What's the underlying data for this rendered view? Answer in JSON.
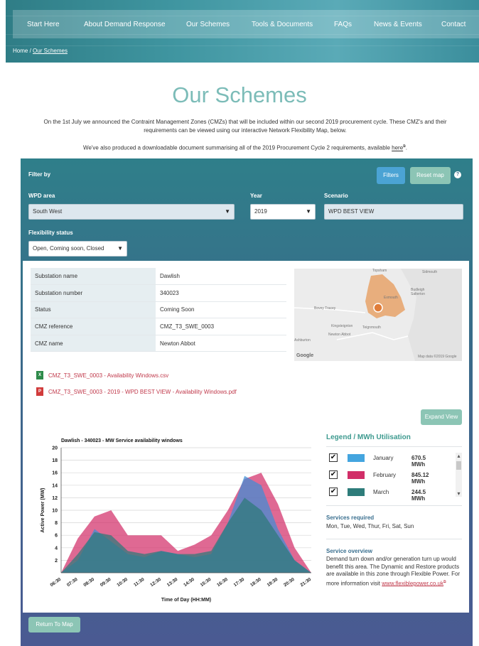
{
  "nav": {
    "items": [
      "Start Here",
      "About Demand Response",
      "Our Schemes",
      "Tools & Documents",
      "FAQs",
      "News & Events",
      "Contact"
    ]
  },
  "breadcrumb": {
    "home": "Home",
    "sep": "/",
    "current": "Our Schemes"
  },
  "page": {
    "title": "Our Schemes",
    "intro_line1": "On the 1st July we announced the Contraint Management Zones (CMZs) that will be included within our second 2019 procurement cycle.   These CMZ's and their",
    "intro_line2": "requirements can be viewed using our interactive Network Flexibility Map, below.",
    "intro_line3": "We've also produced a downloadable document summarising all of the 2019 Procurement Cycle 2 requirements, available",
    "intro_link": "here",
    "intro_link_mark": "⧉",
    "intro_end": "."
  },
  "filters": {
    "filter_by": "Filter by",
    "filters_button": "Filters",
    "reset_button": "Reset map",
    "help_icon": "?",
    "wpd_area_label": "WPD area",
    "wpd_area_value": "South West",
    "year_label": "Year",
    "year_value": "2019",
    "scenario_label": "Scenario",
    "scenario_value": "WPD BEST VIEW",
    "flex_status_label": "Flexibility status",
    "flex_status_value": "Open, Coming soon, Closed"
  },
  "details": {
    "rows": [
      {
        "label": "Substation name",
        "value": "Dawlish"
      },
      {
        "label": "Substation number",
        "value": "340023"
      },
      {
        "label": "Status",
        "value": "Coming Soon"
      },
      {
        "label": "CMZ reference",
        "value": "CMZ_T3_SWE_0003"
      },
      {
        "label": "CMZ name",
        "value": "Newton Abbot"
      }
    ]
  },
  "map": {
    "labels": [
      "Topsham",
      "Sidmouth",
      "Budleigh Salterton",
      "Exmouth",
      "Bovey Tracey",
      "Kingsteignton",
      "Teignmouth",
      "Newton Abbot",
      "Ashburton"
    ],
    "logo": "Google",
    "credit": "Map data ©2019 Google"
  },
  "files": [
    {
      "icon": "csv-file-icon",
      "name": "CMZ_T3_SWE_0003 - Availability Windows.csv"
    },
    {
      "icon": "pdf-file-icon",
      "name": "CMZ_T3_SWE_0003 - 2019 - WPD BEST VIEW - Availability Windows.pdf"
    }
  ],
  "expand_button": "Expand View",
  "chart_data": {
    "type": "area",
    "title": "Dawlish - 340023 - MW Service availability windows",
    "xlabel": "Time of Day (HH:MM)",
    "ylabel": "Active Power (MW)",
    "ylim": [
      0,
      20
    ],
    "yticks": [
      2,
      4,
      6,
      8,
      10,
      12,
      14,
      16,
      18,
      20
    ],
    "x": [
      "06:30",
      "07:30",
      "08:30",
      "09:30",
      "10:30",
      "11:30",
      "12:30",
      "13:30",
      "14:30",
      "15:30",
      "16:30",
      "17:30",
      "18:30",
      "19:30",
      "20:30",
      "21:30"
    ],
    "grid": true,
    "series": [
      {
        "name": "February",
        "color": "#d22f6a",
        "values": [
          0,
          5.5,
          9,
          10,
          6,
          6,
          6,
          3.5,
          4.5,
          6,
          10,
          15,
          16,
          11,
          4,
          0
        ]
      },
      {
        "name": "January",
        "color": "#3f8ed6",
        "values": [
          0,
          2,
          7,
          5,
          3,
          2.5,
          3.5,
          3,
          2.5,
          3,
          8,
          15.5,
          14,
          7,
          2,
          0
        ]
      },
      {
        "name": "March",
        "color": "#2d7a78",
        "values": [
          0,
          3,
          6.5,
          6,
          3.5,
          3,
          3.5,
          3,
          3,
          3.5,
          8,
          12,
          10,
          6,
          2,
          0
        ]
      }
    ]
  },
  "legend": {
    "title": "Legend / MWh Utilisation",
    "items": [
      {
        "name": "January",
        "value": "670.5 MWh",
        "color": "#44a5df",
        "checked": "✔"
      },
      {
        "name": "February",
        "value": "845.12 MWh",
        "color": "#d12e68",
        "checked": "✔"
      },
      {
        "name": "March",
        "value": "244.5 MWh",
        "color": "#2e7c7a",
        "checked": "✔"
      }
    ],
    "scroll_up": "▴",
    "scroll_down": "▾"
  },
  "services": {
    "heading": "Services required",
    "text": "Mon, Tue, Wed, Thur, Fri, Sat, Sun"
  },
  "overview": {
    "heading": "Service overview",
    "text": "Demand turn down and/or generation turn up would benefit this area. The Dynamic and Restore products are available in this zone through Flexible Power. For more information visit",
    "link": "www.flexiblepower.co.uk",
    "link_mark": "⧉"
  },
  "return_button": "Return To Map"
}
